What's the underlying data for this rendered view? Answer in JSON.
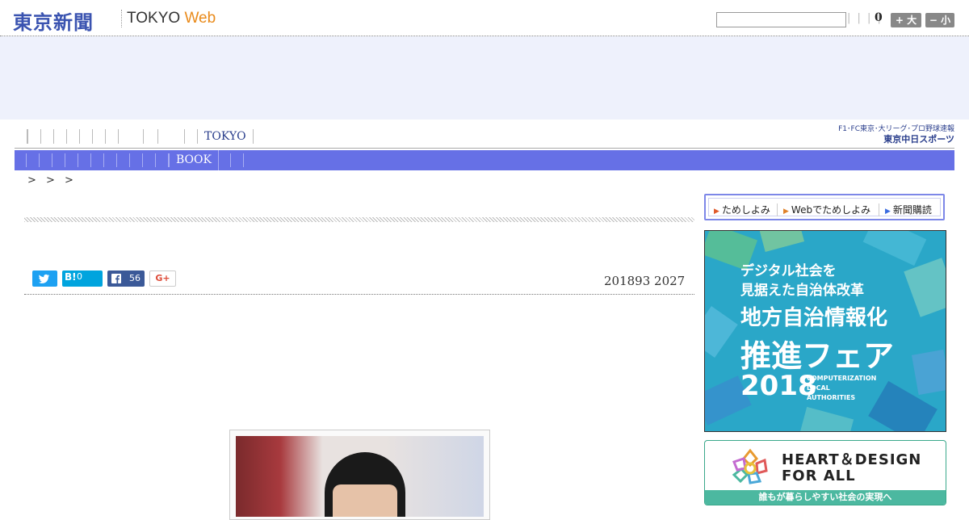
{
  "header": {
    "logo_kanji": "東京新聞",
    "logo_tokyo": "TOKYO ",
    "logo_web": "Web",
    "separators": "| | | |",
    "count": "0",
    "font_larger": "+ 大",
    "font_smaller": "− 小"
  },
  "nav": {
    "tokyo_label": "TOKYO",
    "book_label": "BOOK"
  },
  "chunichi": {
    "subtitle": "F1･FC東京･大リーグ･プロ野球速報",
    "name": "東京中日スポーツ"
  },
  "breadcrumb": "> > >",
  "article": {
    "date": "201893 2027"
  },
  "share": {
    "hatena_label": "B!",
    "hatena_count": "0",
    "facebook_count": "56",
    "gplus_label": "G+"
  },
  "subscribe": {
    "item1": "ためしよみ",
    "item2": "Webでためしよみ",
    "item3": "新聞購読"
  },
  "ad_fair": {
    "line1": "デジタル社会を",
    "line2": "見据えた自治体改革",
    "line3": "地方自治情報化",
    "line4": "推進フェア",
    "year": "2018",
    "en1": "COMPUTERIZATION",
    "en2": "LOCAL",
    "en3": "AUTHORITIES"
  },
  "ad_heart": {
    "title1": "HEART＆DESIGN",
    "title2": "FOR ALL",
    "footer": "誰もが暮らしやすい社会の実現へ"
  },
  "colors": {
    "brand_blue": "#3a53b0",
    "nav_blue": "#6670e6",
    "web_orange": "#e98a1a"
  }
}
